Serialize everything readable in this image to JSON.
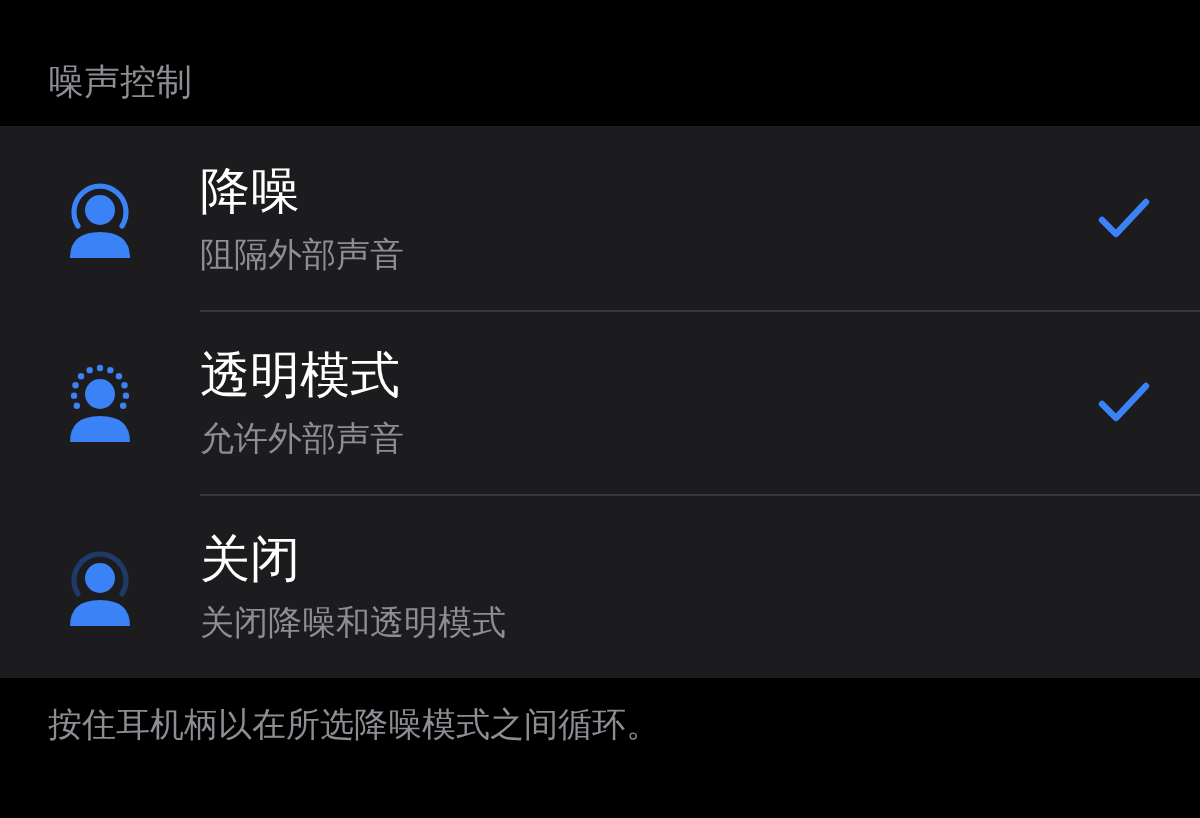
{
  "section_title": "噪声控制",
  "options": [
    {
      "kind": "noise-cancel",
      "title": "降噪",
      "subtitle": "阻隔外部声音",
      "checked": true
    },
    {
      "kind": "transparency",
      "title": "透明模式",
      "subtitle": "允许外部声音",
      "checked": true
    },
    {
      "kind": "off",
      "title": "关闭",
      "subtitle": "关闭降噪和透明模式",
      "checked": false
    }
  ],
  "footer": "按住耳机柄以在所选降噪模式之间循环。"
}
